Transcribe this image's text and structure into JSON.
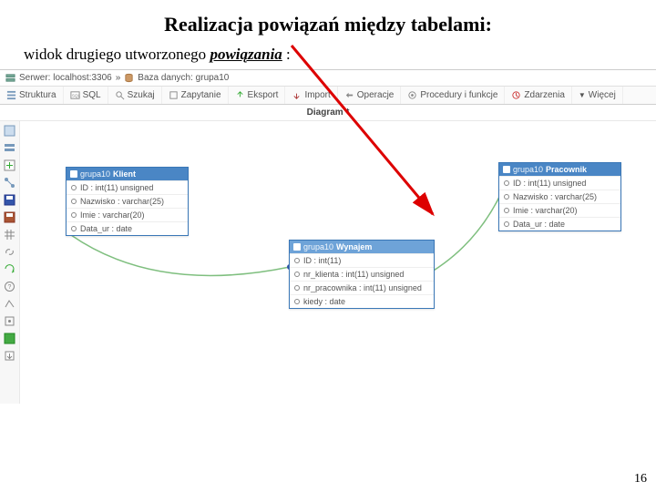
{
  "slide": {
    "title": "Realizacja powiązań między tabelami:",
    "subtitle_pre": "widok drugiego utworzonego ",
    "subtitle_em": "powiązania",
    "subtitle_post": " :"
  },
  "breadcrumb": {
    "server_label": "Serwer: localhost:3306",
    "sep": "»",
    "db_label": "Baza danych: grupa10"
  },
  "toolbar": {
    "struktura": "Struktura",
    "sql": "SQL",
    "szukaj": "Szukaj",
    "zapytanie": "Zapytanie",
    "eksport": "Eksport",
    "import": "Import",
    "operacje": "Operacje",
    "procedury": "Procedury i funkcje",
    "zdarzenia": "Zdarzenia",
    "wiecej": "Więcej"
  },
  "subbar": {
    "title": "Diagram *"
  },
  "tables": {
    "klient": {
      "schema": "grupa10",
      "name": "Klient",
      "cols": [
        "ID : int(11) unsigned",
        "Nazwisko : varchar(25)",
        "Imie : varchar(20)",
        "Data_ur : date"
      ]
    },
    "wynajem": {
      "schema": "grupa10",
      "name": "Wynajem",
      "cols": [
        "ID : int(11)",
        "nr_klienta : int(11) unsigned",
        "nr_pracownika : int(11) unsigned",
        "kiedy : date"
      ]
    },
    "pracownik": {
      "schema": "grupa10",
      "name": "Pracownik",
      "cols": [
        "ID : int(11) unsigned",
        "Nazwisko : varchar(25)",
        "Imie : varchar(20)",
        "Data_ur : date"
      ]
    }
  },
  "page_num": "16"
}
